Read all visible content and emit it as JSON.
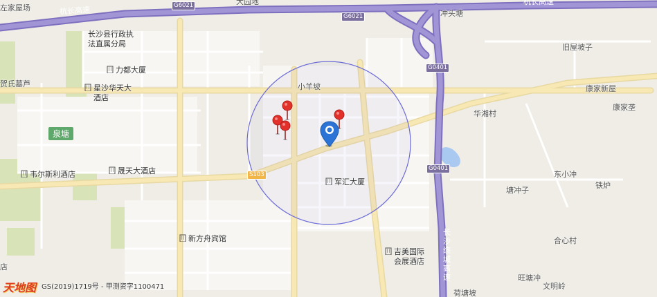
{
  "map": {
    "colors": {
      "background": "#efede6",
      "built_area": "#f7f6f2",
      "green": "#d9e3b8",
      "major_road": "#f7e8b4",
      "expressway": "#9b8ccc",
      "search_radius": "#6a6ad8",
      "water": "#a9c9f0",
      "pin": "#e2302a",
      "center_marker": "#2b74d6"
    },
    "expressway_labels": {
      "north_left": "杭长高速",
      "north_right": "杭长高速",
      "ring": "长沙绕城高速"
    },
    "shields": {
      "g6021_a": "G6021",
      "g6021_b": "G6021",
      "g0401_a": "G0401",
      "g0401_b": "G0401",
      "s103": "S103"
    },
    "places": {
      "zuojiawuchang": "左家屋场",
      "dayuandi": "大园地",
      "chongtoutang": "冲头塘",
      "jiuwupozi": "旧屋坡子",
      "changshaxian_office": "长沙县行政执法直属分局",
      "lidu_building": "力都大厦",
      "heshi_mulu": "贺氏墓芦",
      "xingsha_hotel": "星沙华天大酒店",
      "xiaoyangpo": "小羊坡",
      "kangjiaxinwu": "康家新屋",
      "kangjiazhi": "康家垄",
      "huaxiangcun": "华湘村",
      "quantang": "泉塘",
      "weiersili_hotel": "韦尔斯利酒店",
      "shengtian_hotel": "晟天大酒店",
      "junhui_building": "军汇大厦",
      "dongxiaochong": "东小冲",
      "tangchongzi": "塘冲子",
      "tielu": "铁炉",
      "xinfangzhou_hotel": "新方舟宾馆",
      "jimei_hotel": "吉美国际会展酒店",
      "hexincun": "合心村",
      "wangtangchong": "旺塘冲",
      "wenmingling": "文明岭",
      "hetangpo": "荷塘坡",
      "left_edge": "店"
    },
    "copyright": "GS(2019)1719号 - 甲测资字1100471",
    "logo": "天地图"
  }
}
